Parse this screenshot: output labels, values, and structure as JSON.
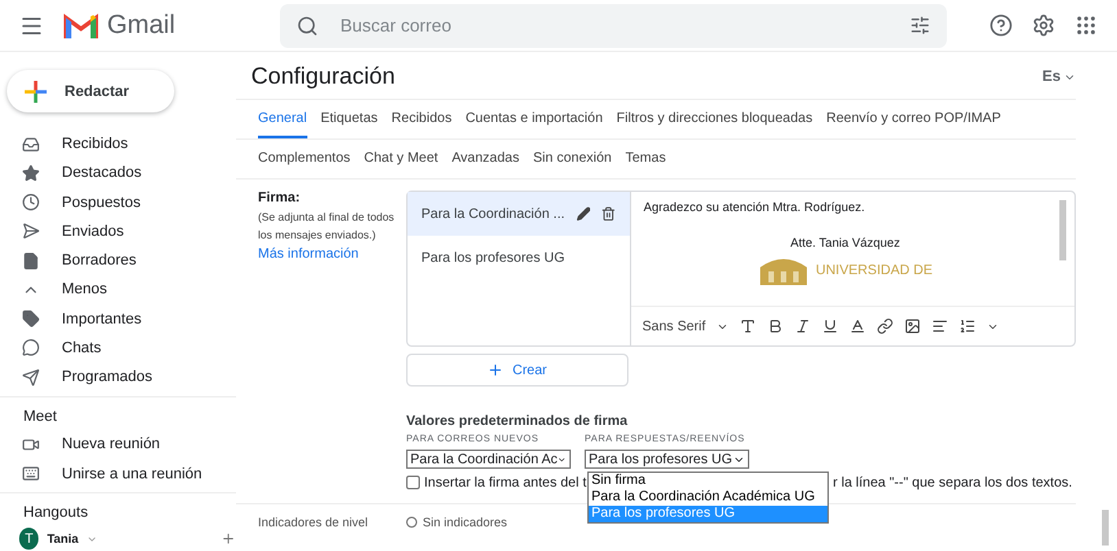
{
  "header": {
    "app_name": "Gmail",
    "search": {
      "placeholder": "Buscar correo"
    }
  },
  "compose": {
    "label": "Redactar"
  },
  "nav": [
    {
      "label": "Recibidos"
    },
    {
      "label": "Destacados"
    },
    {
      "label": "Pospuestos"
    },
    {
      "label": "Enviados"
    },
    {
      "label": "Borradores"
    },
    {
      "label": "Menos"
    },
    {
      "label": "Importantes"
    },
    {
      "label": "Chats"
    },
    {
      "label": "Programados"
    }
  ],
  "meet": {
    "title": "Meet",
    "items": [
      {
        "label": "Nueva reunión"
      },
      {
        "label": "Unirse a una reunión"
      }
    ]
  },
  "hangouts": {
    "title": "Hangouts",
    "user": {
      "initial": "T",
      "name": "Tania"
    }
  },
  "settings": {
    "title": "Configuración",
    "language": "Es",
    "tab_rows": [
      [
        {
          "label": "General",
          "selected": true
        },
        {
          "label": "Etiquetas",
          "selected": false
        },
        {
          "label": "Recibidos",
          "selected": false
        },
        {
          "label": "Cuentas e importación",
          "selected": false
        },
        {
          "label": "Filtros y direcciones bloqueadas",
          "selected": false
        },
        {
          "label": "Reenvío y correo POP/IMAP",
          "selected": false
        }
      ],
      [
        {
          "label": "Complementos",
          "selected": false
        },
        {
          "label": "Chat y Meet",
          "selected": false
        },
        {
          "label": "Avanzadas",
          "selected": false
        },
        {
          "label": "Sin conexión",
          "selected": false
        },
        {
          "label": "Temas",
          "selected": false
        }
      ]
    ]
  },
  "signature": {
    "label": "Firma:",
    "note": "(Se adjunta al final de todos los mensajes enviados.)",
    "link": "Más información",
    "items": [
      {
        "name": "Para la Coordinación ...",
        "selected": true
      },
      {
        "name": "Para los profesores UG",
        "selected": false
      }
    ],
    "editor": {
      "greeting": "Agradezco su atención Mtra. Rodríguez.",
      "sign_off": "Atte. Tania Vázquez",
      "logo_text": "UNIVERSIDAD DE",
      "font": "Sans Serif"
    },
    "create": "Crear"
  },
  "defaults": {
    "title": "Valores predeterminados de firma",
    "new_label": "PARA CORREOS NUEVOS",
    "new_value": "Para la Coordinación Ac",
    "reply_label": "PARA RESPUESTAS/REENVÍOS",
    "reply_value": "Para los profesores UG",
    "options": [
      {
        "label": "Sin firma",
        "selected": false
      },
      {
        "label": "Para la Coordinación Académica UG",
        "selected": false
      },
      {
        "label": "Para los profesores UG",
        "selected": true
      }
    ],
    "insert": {
      "checked": false,
      "text_before": "Insertar la firma antes del t",
      "text_after": "r la línea \"--\" que separa los dos textos."
    }
  },
  "indicators": {
    "label": "Indicadores de nivel",
    "option": {
      "label": "Sin indicadores",
      "selected": false
    }
  }
}
